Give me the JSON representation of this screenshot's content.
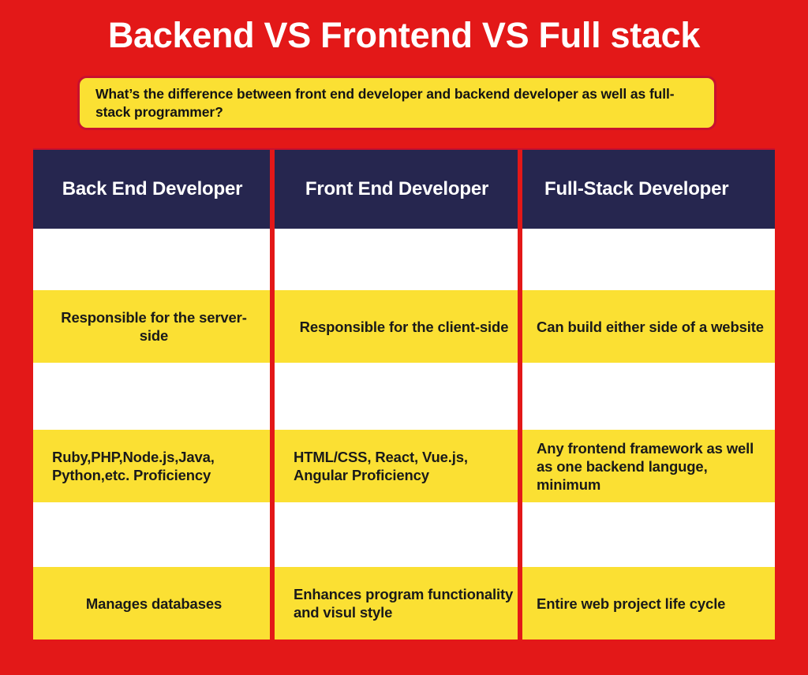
{
  "page": {
    "title": "Backend VS Frontend VS Full stack",
    "subtitle": "What’s the difference between front end developer and backend developer as well as full-stack programmer?",
    "colors": {
      "background_red": "#E31818",
      "header_navy": "#26264F",
      "band_yellow": "#FBE033",
      "callout_border": "#C8102E",
      "text_dark": "#1A1A1A",
      "text_light": "#FFFFFF"
    },
    "watermark": {
      "name": "play-triangle-logo",
      "colors": [
        "#F6C9CC",
        "#DDDDDD",
        "#F5C518"
      ]
    }
  },
  "table": {
    "columns": [
      {
        "id": "back-end",
        "header": "Back End Developer"
      },
      {
        "id": "front-end",
        "header": "Front End Developer"
      },
      {
        "id": "full-stack",
        "header": "Full-Stack Developer"
      }
    ],
    "rows": [
      {
        "id": "responsibility",
        "cells": [
          "Responsible for the server-side",
          "Responsible for the client-side",
          "Can build either side of a website"
        ]
      },
      {
        "id": "skills",
        "cells": [
          "Ruby,PHP,Node.js,Java, Python,etc. Proficiency",
          "HTML/CSS, React, Vue.js, Angular Proficiency",
          "Any frontend framework as well as one backend languge, minimum"
        ]
      },
      {
        "id": "scope",
        "cells": [
          "Manages databases",
          "Enhances program functionality and visul style",
          "Entire web project life cycle"
        ]
      }
    ]
  }
}
